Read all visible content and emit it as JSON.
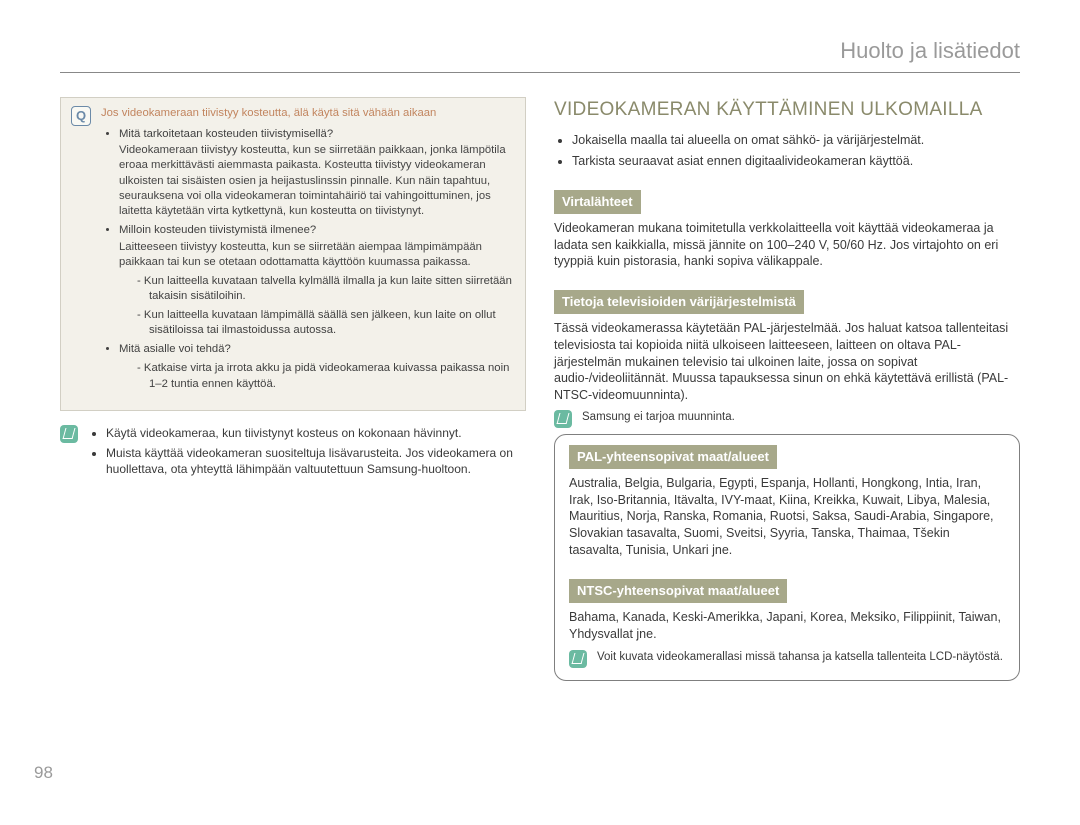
{
  "header": {
    "title": "Huolto ja lisätiedot"
  },
  "page_number": "98",
  "left": {
    "notice_title": "Jos videokameraan tiivistyy kosteutta, älä käytä sitä vähään aikaan",
    "q1": "Mitä tarkoitetaan kosteuden tiivistymisellä?",
    "q1_a": "Videokameraan tiivistyy kosteutta, kun se siirretään paikkaan, jonka lämpötila eroaa merkittävästi aiemmasta paikasta. Kosteutta tiivistyy videokameran ulkoisten tai sisäisten osien ja heijastuslinssin pinnalle. Kun näin tapahtuu, seurauksena voi olla videokameran toimintahäiriö tai vahingoittuminen, jos laitetta käytetään virta kytkettynä, kun kosteutta on tiivistynyt.",
    "q2": "Milloin kosteuden tiivistymistä ilmenee?",
    "q2_a": "Laitteeseen tiivistyy kosteutta, kun se siirretään aiempaa lämpimämpään paikkaan tai kun se otetaan odottamatta käyttöön kuumassa paikassa.",
    "q2_d1": "Kun laitteella kuvataan talvella kylmällä ilmalla ja kun laite sitten siirretään takaisin sisätiloihin.",
    "q2_d2": "Kun laitteella kuvataan lämpimällä säällä sen jälkeen, kun laite on ollut sisätiloissa tai ilmastoidussa autossa.",
    "q3": "Mitä asialle voi tehdä?",
    "q3_d1": "Katkaise virta ja irrota akku ja pidä videokameraa kuivassa paikassa noin 1–2 tuntia ennen käyttöä.",
    "tip1": "Käytä videokameraa, kun tiivistynyt kosteus on kokonaan hävinnyt.",
    "tip2": "Muista käyttää videokameran suositeltuja lisävarusteita. Jos videokamera on huollettava, ota yhteyttä lähimpään valtuutettuun Samsung-huoltoon."
  },
  "right": {
    "section_title": "VIDEOKAMERAN KÄYTTÄMINEN ULKOMAILLA",
    "intro_b1": "Jokaisella maalla tai alueella on omat sähkö- ja värijärjestelmät.",
    "intro_b2": "Tarkista seuraavat asiat ennen digitaalivideokameran käyttöä.",
    "h_power": "Virtalähteet",
    "p_power": "Videokameran mukana toimitetulla verkkolaitteella voit käyttää videokameraa ja ladata sen kaikkialla, missä jännite on 100–240 V, 50/60 Hz. Jos virtajohto on eri tyyppiä kuin pistorasia, hanki sopiva välikappale.",
    "h_tv": "Tietoja televisioiden värijärjestelmistä",
    "p_tv": "Tässä videokamerassa käytetään PAL-järjestelmää. Jos haluat katsoa tallenteitasi televisiosta tai kopioida niitä ulkoiseen laitteeseen, laitteen on oltava PAL-järjestelmän mukainen televisio tai ulkoinen laite, jossa on sopivat audio-/videoliitännät. Muussa tapauksessa sinun on ehkä käytettävä erillistä (PAL-NTSC-videomuunninta).",
    "tv_note": "Samsung ei tarjoa muunninta.",
    "h_pal": "PAL-yhteensopivat maat/alueet",
    "p_pal": "Australia, Belgia, Bulgaria, Egypti, Espanja, Hollanti, Hongkong, Intia, Iran, Irak, Iso-Britannia, Itävalta, IVY-maat, Kiina, Kreikka, Kuwait, Libya, Malesia, Mauritius, Norja, Ranska, Romania, Ruotsi, Saksa, Saudi-Arabia, Singapore, Slovakian tasavalta, Suomi, Sveitsi, Syyria, Tanska, Thaimaa, Tšekin tasavalta, Tunisia, Unkari jne.",
    "h_ntsc": "NTSC-yhteensopivat maat/alueet",
    "p_ntsc": "Bahama, Kanada, Keski-Amerikka, Japani, Korea, Meksiko, Filippiinit, Taiwan, Yhdysvallat jne.",
    "end_note": "Voit kuvata videokamerallasi missä tahansa ja katsella tallenteita LCD-näytöstä."
  }
}
